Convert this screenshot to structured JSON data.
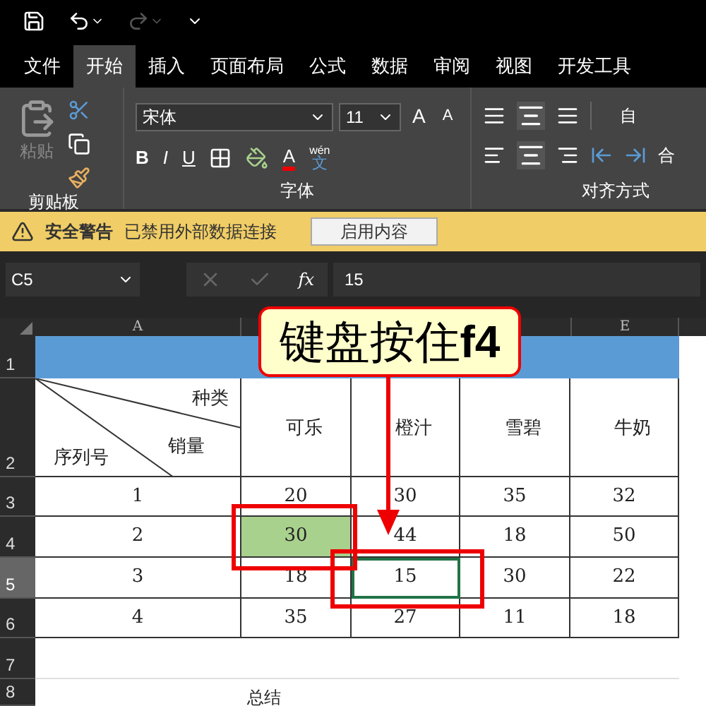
{
  "quick_access": {
    "items": [
      {
        "kind": "save"
      },
      {
        "kind": "undo"
      },
      {
        "kind": "redo",
        "disabled": true
      },
      {
        "kind": "customize"
      }
    ]
  },
  "tabs": [
    {
      "label": "文件",
      "selected": false
    },
    {
      "label": "开始",
      "selected": true
    },
    {
      "label": "插入",
      "selected": false
    },
    {
      "label": "页面布局",
      "selected": false
    },
    {
      "label": "公式",
      "selected": false
    },
    {
      "label": "数据",
      "selected": false
    },
    {
      "label": "审阅",
      "selected": false
    },
    {
      "label": "视图",
      "selected": false
    },
    {
      "label": "开发工具",
      "selected": false
    }
  ],
  "ribbon": {
    "clipboard": {
      "paste_label": "粘贴",
      "label": "剪贴板"
    },
    "font": {
      "font_name": "宋体",
      "font_size": "11",
      "bold": "B",
      "italic": "I",
      "underline": "U",
      "font_color": "A",
      "grow": "A",
      "shrink": "A",
      "phonetic_top": "wén",
      "phonetic_bottom": "文",
      "label": "字体"
    },
    "alignment": {
      "wrap_text": "自",
      "merge": "合",
      "label": "对齐方式"
    }
  },
  "security_bar": {
    "title": "安全警告",
    "message": "已禁用外部数据连接",
    "button": "启用内容"
  },
  "formula_bar": {
    "name_box": "C5",
    "fx": "fx",
    "value": "15"
  },
  "sheet": {
    "column_headers": [
      {
        "label": "A"
      },
      {
        "label": "E"
      }
    ],
    "row_headers": [
      {
        "label": "1",
        "selected": false
      },
      {
        "label": "2",
        "selected": false
      },
      {
        "label": "3",
        "selected": false
      },
      {
        "label": "4",
        "selected": false
      },
      {
        "label": "5",
        "selected": true
      },
      {
        "label": "6",
        "selected": false
      },
      {
        "label": "7",
        "selected": false
      },
      {
        "label": "8",
        "selected": false
      }
    ],
    "header_cell": {
      "top": "种类",
      "middle": "销量",
      "bottom": "序列号"
    },
    "column_titles": [
      "可乐",
      "橙汁",
      "雪碧",
      "牛奶"
    ],
    "rows": [
      {
        "cells": [
          {
            "text": "1"
          },
          {
            "text": "20"
          },
          {
            "text": "30"
          },
          {
            "text": "35"
          },
          {
            "text": "32"
          }
        ]
      },
      {
        "cells": [
          {
            "text": "2"
          },
          {
            "text": "30",
            "highlighted": true
          },
          {
            "text": "44"
          },
          {
            "text": "18"
          },
          {
            "text": "50"
          }
        ]
      },
      {
        "cells": [
          {
            "text": "3"
          },
          {
            "text": "18"
          },
          {
            "text": "15",
            "selected": true
          },
          {
            "text": "30"
          },
          {
            "text": "22"
          }
        ]
      },
      {
        "cells": [
          {
            "text": "4"
          },
          {
            "text": "35"
          },
          {
            "text": "27"
          },
          {
            "text": "11"
          },
          {
            "text": "18"
          }
        ]
      }
    ],
    "footer_text": "总结"
  },
  "callout": {
    "text": "键盘按住**f4**"
  }
}
